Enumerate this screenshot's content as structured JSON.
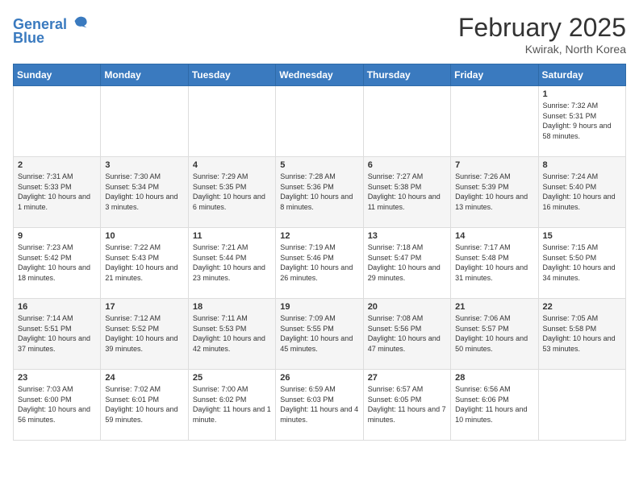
{
  "header": {
    "logo_line1": "General",
    "logo_line2": "Blue",
    "title": "February 2025",
    "subtitle": "Kwirak, North Korea"
  },
  "weekdays": [
    "Sunday",
    "Monday",
    "Tuesday",
    "Wednesday",
    "Thursday",
    "Friday",
    "Saturday"
  ],
  "weeks": [
    [
      {
        "day": "",
        "info": ""
      },
      {
        "day": "",
        "info": ""
      },
      {
        "day": "",
        "info": ""
      },
      {
        "day": "",
        "info": ""
      },
      {
        "day": "",
        "info": ""
      },
      {
        "day": "",
        "info": ""
      },
      {
        "day": "1",
        "info": "Sunrise: 7:32 AM\nSunset: 5:31 PM\nDaylight: 9 hours and 58 minutes."
      }
    ],
    [
      {
        "day": "2",
        "info": "Sunrise: 7:31 AM\nSunset: 5:33 PM\nDaylight: 10 hours and 1 minute."
      },
      {
        "day": "3",
        "info": "Sunrise: 7:30 AM\nSunset: 5:34 PM\nDaylight: 10 hours and 3 minutes."
      },
      {
        "day": "4",
        "info": "Sunrise: 7:29 AM\nSunset: 5:35 PM\nDaylight: 10 hours and 6 minutes."
      },
      {
        "day": "5",
        "info": "Sunrise: 7:28 AM\nSunset: 5:36 PM\nDaylight: 10 hours and 8 minutes."
      },
      {
        "day": "6",
        "info": "Sunrise: 7:27 AM\nSunset: 5:38 PM\nDaylight: 10 hours and 11 minutes."
      },
      {
        "day": "7",
        "info": "Sunrise: 7:26 AM\nSunset: 5:39 PM\nDaylight: 10 hours and 13 minutes."
      },
      {
        "day": "8",
        "info": "Sunrise: 7:24 AM\nSunset: 5:40 PM\nDaylight: 10 hours and 16 minutes."
      }
    ],
    [
      {
        "day": "9",
        "info": "Sunrise: 7:23 AM\nSunset: 5:42 PM\nDaylight: 10 hours and 18 minutes."
      },
      {
        "day": "10",
        "info": "Sunrise: 7:22 AM\nSunset: 5:43 PM\nDaylight: 10 hours and 21 minutes."
      },
      {
        "day": "11",
        "info": "Sunrise: 7:21 AM\nSunset: 5:44 PM\nDaylight: 10 hours and 23 minutes."
      },
      {
        "day": "12",
        "info": "Sunrise: 7:19 AM\nSunset: 5:46 PM\nDaylight: 10 hours and 26 minutes."
      },
      {
        "day": "13",
        "info": "Sunrise: 7:18 AM\nSunset: 5:47 PM\nDaylight: 10 hours and 29 minutes."
      },
      {
        "day": "14",
        "info": "Sunrise: 7:17 AM\nSunset: 5:48 PM\nDaylight: 10 hours and 31 minutes."
      },
      {
        "day": "15",
        "info": "Sunrise: 7:15 AM\nSunset: 5:50 PM\nDaylight: 10 hours and 34 minutes."
      }
    ],
    [
      {
        "day": "16",
        "info": "Sunrise: 7:14 AM\nSunset: 5:51 PM\nDaylight: 10 hours and 37 minutes."
      },
      {
        "day": "17",
        "info": "Sunrise: 7:12 AM\nSunset: 5:52 PM\nDaylight: 10 hours and 39 minutes."
      },
      {
        "day": "18",
        "info": "Sunrise: 7:11 AM\nSunset: 5:53 PM\nDaylight: 10 hours and 42 minutes."
      },
      {
        "day": "19",
        "info": "Sunrise: 7:09 AM\nSunset: 5:55 PM\nDaylight: 10 hours and 45 minutes."
      },
      {
        "day": "20",
        "info": "Sunrise: 7:08 AM\nSunset: 5:56 PM\nDaylight: 10 hours and 47 minutes."
      },
      {
        "day": "21",
        "info": "Sunrise: 7:06 AM\nSunset: 5:57 PM\nDaylight: 10 hours and 50 minutes."
      },
      {
        "day": "22",
        "info": "Sunrise: 7:05 AM\nSunset: 5:58 PM\nDaylight: 10 hours and 53 minutes."
      }
    ],
    [
      {
        "day": "23",
        "info": "Sunrise: 7:03 AM\nSunset: 6:00 PM\nDaylight: 10 hours and 56 minutes."
      },
      {
        "day": "24",
        "info": "Sunrise: 7:02 AM\nSunset: 6:01 PM\nDaylight: 10 hours and 59 minutes."
      },
      {
        "day": "25",
        "info": "Sunrise: 7:00 AM\nSunset: 6:02 PM\nDaylight: 11 hours and 1 minute."
      },
      {
        "day": "26",
        "info": "Sunrise: 6:59 AM\nSunset: 6:03 PM\nDaylight: 11 hours and 4 minutes."
      },
      {
        "day": "27",
        "info": "Sunrise: 6:57 AM\nSunset: 6:05 PM\nDaylight: 11 hours and 7 minutes."
      },
      {
        "day": "28",
        "info": "Sunrise: 6:56 AM\nSunset: 6:06 PM\nDaylight: 11 hours and 10 minutes."
      },
      {
        "day": "",
        "info": ""
      }
    ]
  ]
}
